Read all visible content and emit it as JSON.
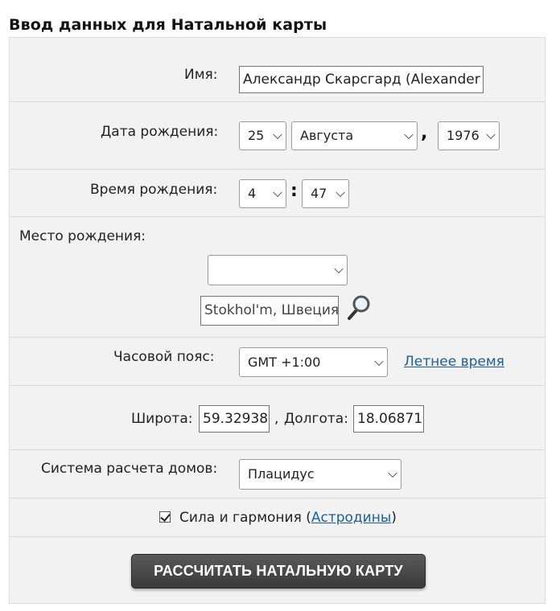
{
  "title": "Ввод данных для Натальной карты",
  "name": {
    "label": "Имя:",
    "value": "Александр Скарсгард (Alexander"
  },
  "birth_date": {
    "label": "Дата рождения:",
    "day": "25",
    "month": "Августа",
    "separator": ",",
    "year": "1976"
  },
  "birth_time": {
    "label": "Время рождения:",
    "hour": "4",
    "separator": ":",
    "minute": "47"
  },
  "birth_place": {
    "label": "Место рождения:",
    "select_value": "",
    "search_value": "Stokhol'm, Швеция"
  },
  "timezone": {
    "label": "Часовой пояс:",
    "value": "GMT +1:00",
    "dst_link": "Летнее время"
  },
  "coords": {
    "lat_label": "Широта:",
    "lat_value": "59.32938",
    "separator": ",",
    "lon_label": "Долгота:",
    "lon_value": "18.06871"
  },
  "house_system": {
    "label": "Система расчета домов:",
    "value": "Плацидус"
  },
  "options": {
    "checked": true,
    "label_before": "Сила и гармония (",
    "link": "Астродины",
    "label_after": ")"
  },
  "submit_label": "РАССЧИТАТЬ НАТАЛЬНУЮ КАРТУ",
  "colors": {
    "link": "#1a5f9c",
    "panel_bg": "#f2f2f2",
    "button_bg": "#444444"
  }
}
